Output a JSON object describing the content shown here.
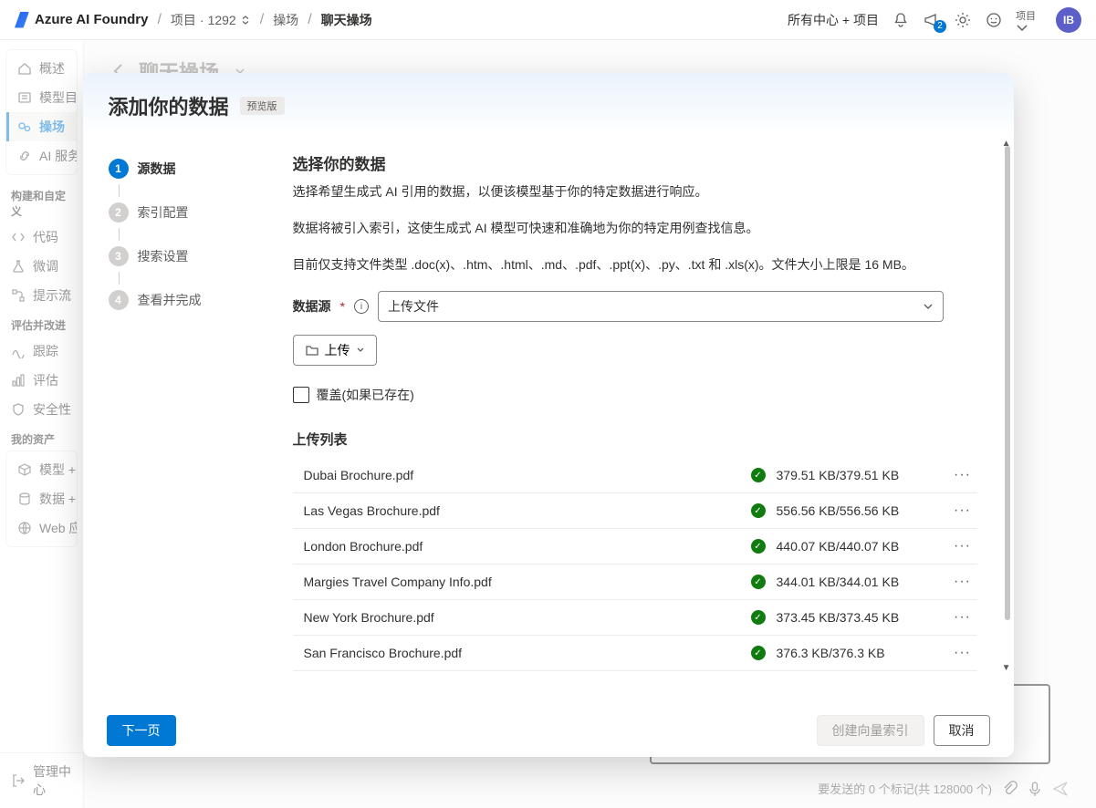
{
  "header": {
    "product": "Azure AI Foundry",
    "crumb_project_prefix": "项目",
    "crumb_project_id": "1292",
    "crumb_playground": "操场",
    "crumb_chat_playground": "聊天操场",
    "all_hubs_label": "所有中心 + 项目",
    "project_label": "项目",
    "notification_count": "2",
    "avatar_initials": "IB"
  },
  "sidebar": {
    "items": [
      {
        "icon": "home-icon",
        "label": "概述"
      },
      {
        "icon": "catalog-icon",
        "label": "模型目"
      },
      {
        "icon": "playground-icon",
        "label": "操场",
        "active": true
      },
      {
        "icon": "link-icon",
        "label": "AI 服务"
      }
    ],
    "group_build": "构建和自定义",
    "build_items": [
      {
        "icon": "code-icon",
        "label": "代码"
      },
      {
        "icon": "flask-icon",
        "label": "微调"
      },
      {
        "icon": "flow-icon",
        "label": "提示流"
      }
    ],
    "group_eval": "评估并改进",
    "eval_items": [
      {
        "icon": "trace-icon",
        "label": "跟踪"
      },
      {
        "icon": "eval-icon",
        "label": "评估"
      },
      {
        "icon": "shield-icon",
        "label": "安全性"
      }
    ],
    "group_assets": "我的资产",
    "asset_items": [
      {
        "icon": "cube-icon",
        "label": "模型 + "
      },
      {
        "icon": "db-icon",
        "label": "数据 + "
      },
      {
        "icon": "web-icon",
        "label": "Web 应"
      }
    ],
    "footer_label": "管理中心"
  },
  "main": {
    "page_title": "聊天操场",
    "token_hint": "要发送的 0 个标记(共 128000 个)"
  },
  "modal": {
    "title": "添加你的数据",
    "preview_badge": "预览版",
    "steps": [
      {
        "num": "1",
        "label": "源数据",
        "active": true
      },
      {
        "num": "2",
        "label": "索引配置"
      },
      {
        "num": "3",
        "label": "搜索设置"
      },
      {
        "num": "4",
        "label": "查看并完成"
      }
    ],
    "content": {
      "heading": "选择你的数据",
      "p1": "选择希望生成式 AI 引用的数据，以便该模型基于你的特定数据进行响应。",
      "p2": "数据将被引入索引，这使生成式 AI 模型可快速和准确地为你的特定用例查找信息。",
      "p3": "目前仅支持文件类型 .doc(x)、.htm、.html、.md、.pdf、.ppt(x)、.py、.txt 和 .xls(x)。文件大小上限是 16 MB。",
      "datasource_label": "数据源",
      "select_value": "上传文件",
      "upload_btn": "上传",
      "overwrite_label": "覆盖(如果已存在)",
      "list_title": "上传列表",
      "files": [
        {
          "name": "Dubai Brochure.pdf",
          "size": "379.51 KB/379.51 KB"
        },
        {
          "name": "Las Vegas Brochure.pdf",
          "size": "556.56 KB/556.56 KB"
        },
        {
          "name": "London Brochure.pdf",
          "size": "440.07 KB/440.07 KB"
        },
        {
          "name": "Margies Travel Company Info.pdf",
          "size": "344.01 KB/344.01 KB"
        },
        {
          "name": "New York Brochure.pdf",
          "size": "373.45 KB/373.45 KB"
        },
        {
          "name": "San Francisco Brochure.pdf",
          "size": "376.3 KB/376.3 KB"
        }
      ]
    },
    "footer": {
      "next": "下一页",
      "create_index": "创建向量索引",
      "cancel": "取消"
    }
  }
}
